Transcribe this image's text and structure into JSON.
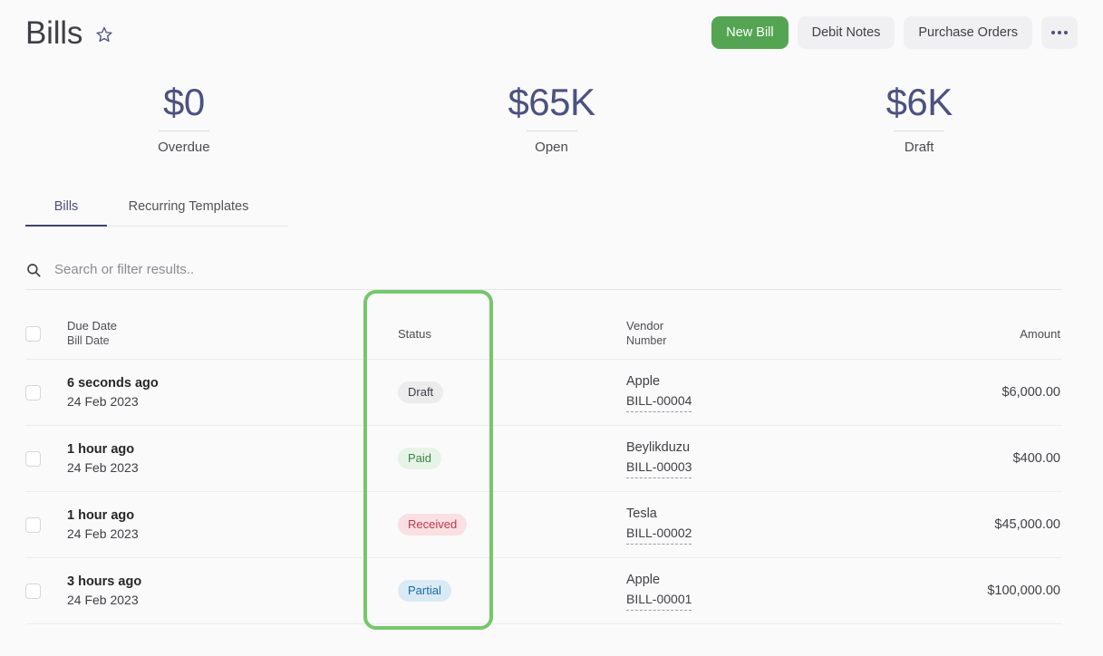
{
  "header": {
    "title": "Bills",
    "star_icon": "star-outline-icon",
    "actions": [
      {
        "label": "New Bill",
        "style": "primary",
        "name": "new-bill-button"
      },
      {
        "label": "Debit Notes",
        "style": "secondary",
        "name": "debit-notes-button"
      },
      {
        "label": "Purchase Orders",
        "style": "secondary",
        "name": "purchase-orders-button"
      }
    ],
    "more_button": {
      "icon": "ellipsis-horizontal-icon",
      "label": ""
    }
  },
  "stats": [
    {
      "value": "$0",
      "label": "Overdue"
    },
    {
      "value": "$65K",
      "label": "Open"
    },
    {
      "value": "$6K",
      "label": "Draft"
    }
  ],
  "tabs": [
    {
      "label": "Bills",
      "active": true
    },
    {
      "label": "Recurring Templates",
      "active": false
    }
  ],
  "search": {
    "icon": "search-icon",
    "placeholder": "Search or filter results..",
    "value": ""
  },
  "table": {
    "columns": {
      "due_date_main": "Due Date",
      "due_date_sub": "Bill Date",
      "status": "Status",
      "vendor_main": "Vendor",
      "vendor_sub": "Number",
      "amount": "Amount"
    },
    "rows": [
      {
        "due_date": "6 seconds ago",
        "bill_date": "24 Feb 2023",
        "status": "Draft",
        "status_class": "badge-draft",
        "vendor": "Apple",
        "number": "BILL-00004",
        "amount": "$6,000.00"
      },
      {
        "due_date": "1 hour ago",
        "bill_date": "24 Feb 2023",
        "status": "Paid",
        "status_class": "badge-paid",
        "vendor": "Beylikduzu",
        "number": "BILL-00003",
        "amount": "$400.00"
      },
      {
        "due_date": "1 hour ago",
        "bill_date": "24 Feb 2023",
        "status": "Received",
        "status_class": "badge-received",
        "vendor": "Tesla",
        "number": "BILL-00002",
        "amount": "$45,000.00"
      },
      {
        "due_date": "3 hours ago",
        "bill_date": "24 Feb 2023",
        "status": "Partial",
        "status_class": "badge-partial",
        "vendor": "Apple",
        "number": "BILL-00001",
        "amount": "$100,000.00"
      }
    ]
  },
  "highlight": {
    "target": "status-column",
    "color": "#74c86a"
  },
  "colors": {
    "accent_green": "#53a551",
    "highlight_green": "#74c86a",
    "stat_navy": "#4c5182",
    "tab_active": "#3f4374",
    "page_background": "#fafafa"
  }
}
